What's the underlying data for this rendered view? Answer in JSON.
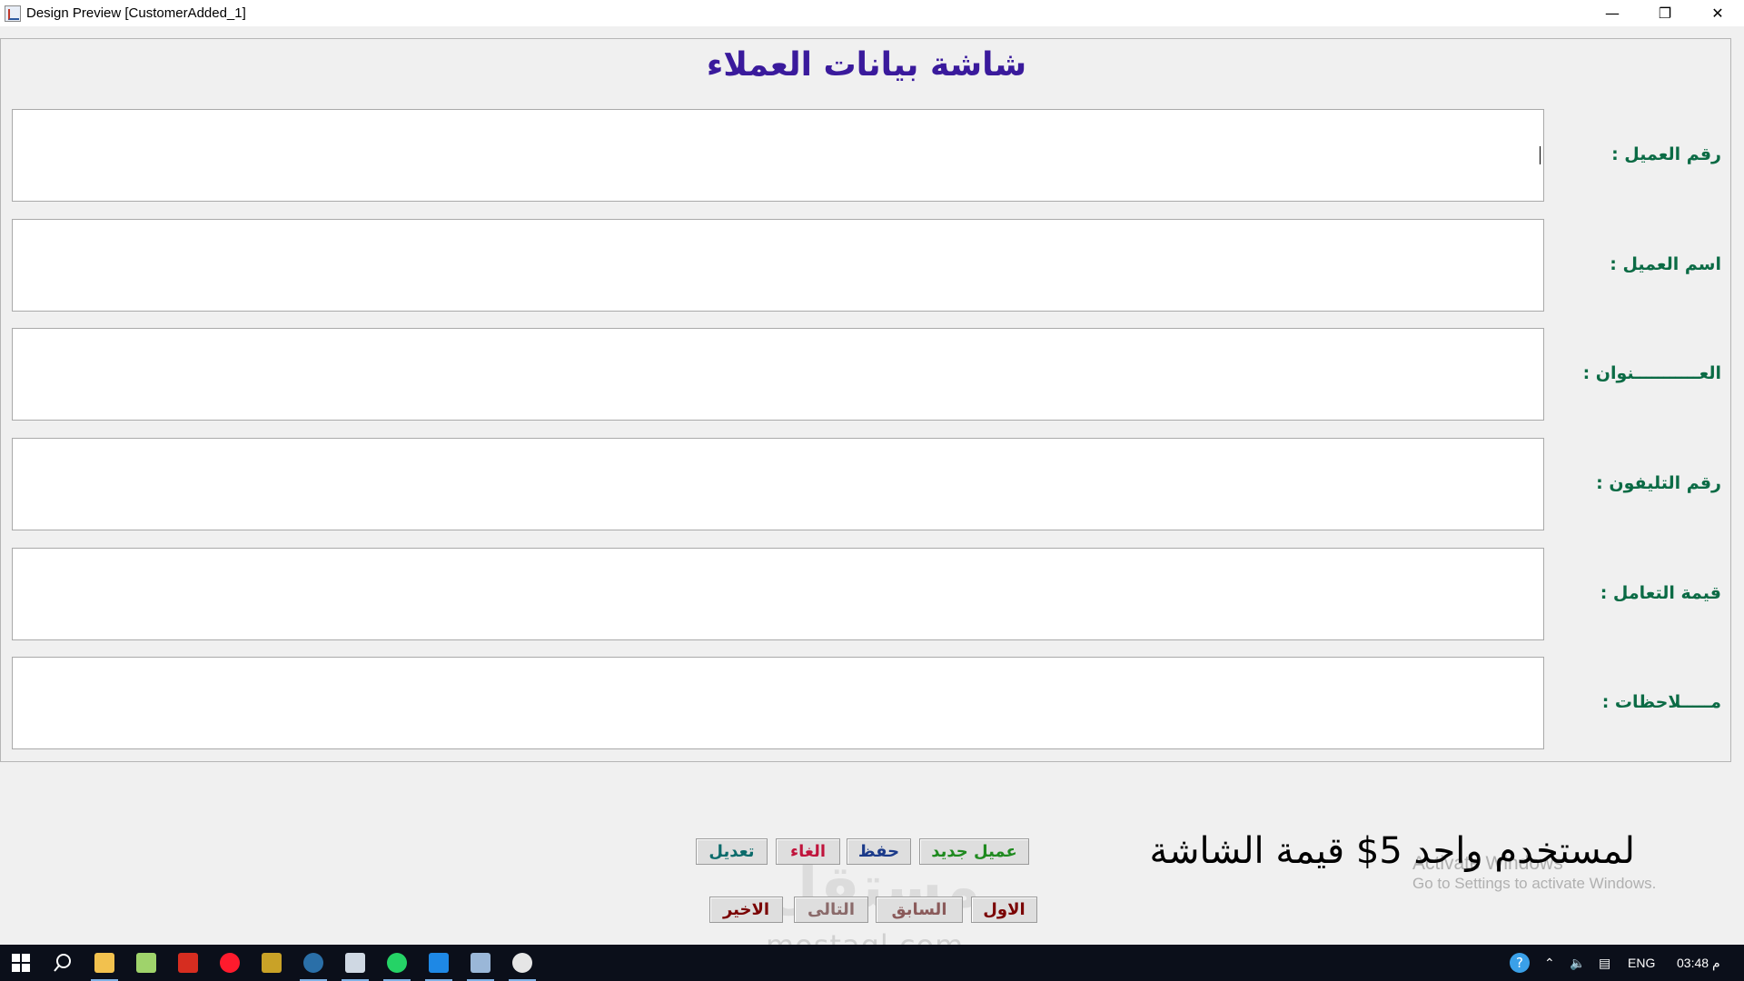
{
  "window": {
    "title": "Design Preview [CustomerAdded_1]",
    "minimize_glyph": "—",
    "maximize_glyph": "❐",
    "close_glyph": "✕"
  },
  "form": {
    "title": "شاشة بيانات العملاء",
    "fields": [
      {
        "label": "رقم العميل :",
        "value": ""
      },
      {
        "label": "اسم العميل :",
        "value": ""
      },
      {
        "label": "العـــــــــــنوان :",
        "value": ""
      },
      {
        "label": "رقم التليفون :",
        "value": ""
      },
      {
        "label": "قيمة التعامل :",
        "value": ""
      },
      {
        "label": "مـــــلاحظات :",
        "value": ""
      }
    ]
  },
  "buttons": {
    "new_customer": "عميل جديد",
    "save": "حفظ",
    "cancel": "الغاء",
    "edit": "تعديل",
    "first": "الاول",
    "previous": "السابق",
    "next": "التالى",
    "last": "الاخير"
  },
  "price_note": "لمستخدم واحد 5$ قيمة الشاشة",
  "activation": {
    "line1": "Activate Windows",
    "line2": "Go to Settings to activate Windows."
  },
  "watermark": {
    "text": "mostaql.com",
    "logo": "مستقل"
  },
  "taskbar": {
    "language": "ENG",
    "time": "03:48 م",
    "icons": [
      "windows-start-icon",
      "search-icon",
      "file-explorer-icon",
      "notepad-icon",
      "acrobat-icon",
      "opera-icon",
      "image-editor-icon",
      "app-icon",
      "document-icon",
      "whatsapp-icon",
      "settings-app-icon",
      "java-app-icon",
      "paint-icon"
    ]
  },
  "colors": {
    "title": "#3a1a9c",
    "label": "#0b6b45",
    "new_customer": "#1f8a1f",
    "save": "#1b3a8a",
    "cancel": "#c0143c",
    "edit": "#0b6b6b",
    "first": "#7a0000",
    "previous": "#8a5a5a",
    "next": "#8a6a6a",
    "last": "#7a0000"
  }
}
